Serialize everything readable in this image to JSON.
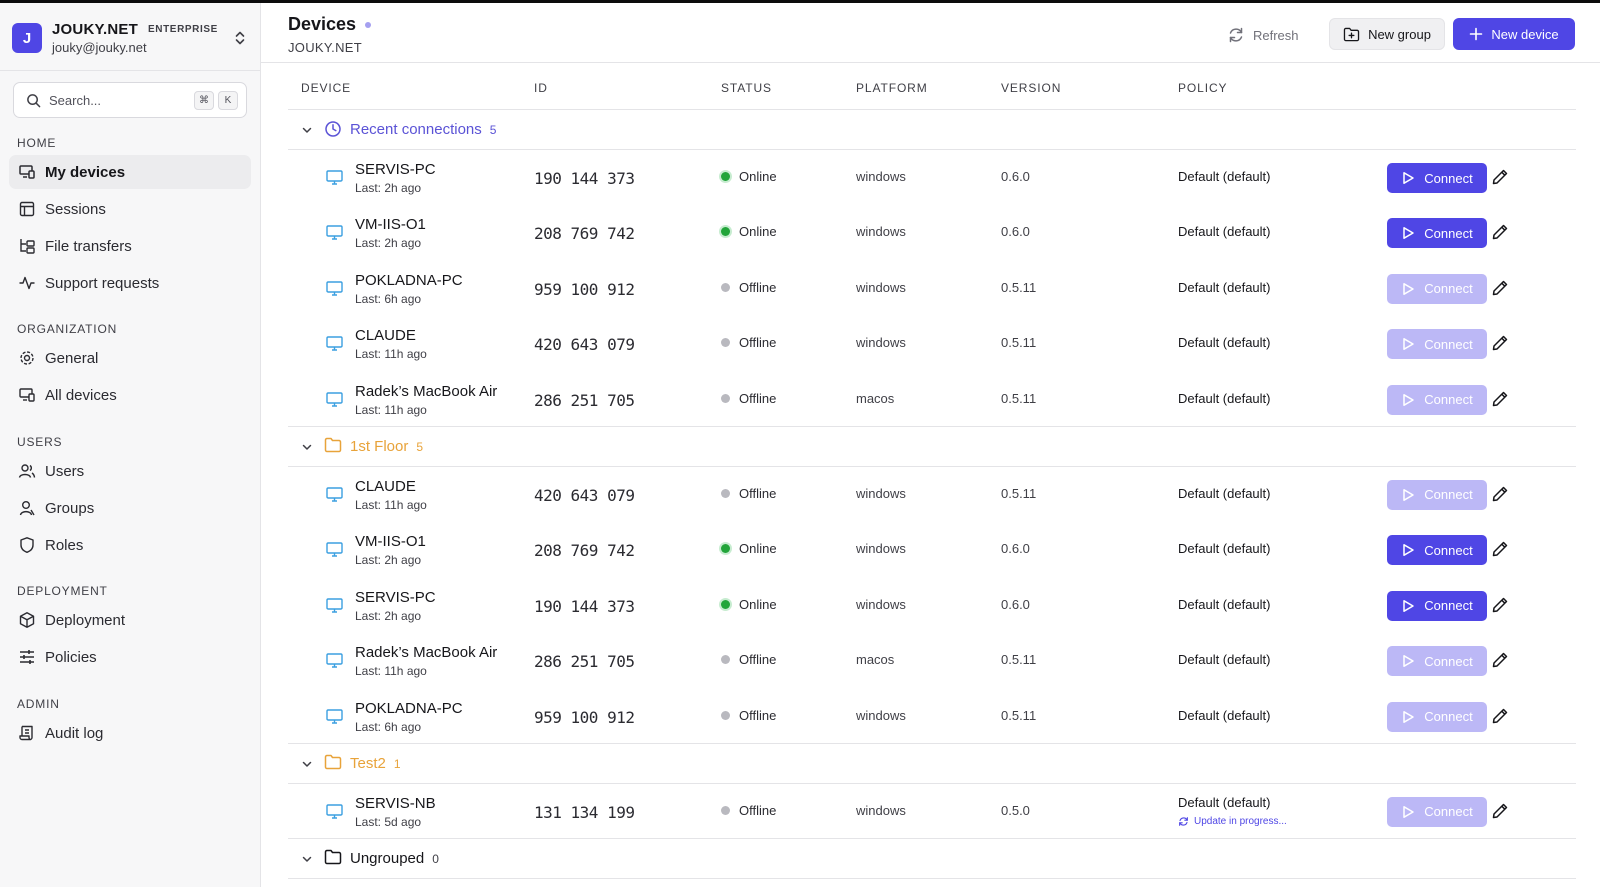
{
  "org": {
    "initial": "J",
    "name": "JOUKY.NET",
    "plan": "ENTERPRISE",
    "email": "jouky@jouky.net"
  },
  "search": {
    "placeholder": "Search...",
    "kbd1": "⌘",
    "kbd2": "K"
  },
  "nav": {
    "home": {
      "title": "HOME",
      "items": [
        "My devices",
        "Sessions",
        "File transfers",
        "Support requests"
      ]
    },
    "organization": {
      "title": "ORGANIZATION",
      "items": [
        "General",
        "All devices"
      ]
    },
    "users": {
      "title": "USERS",
      "items": [
        "Users",
        "Groups",
        "Roles"
      ]
    },
    "deployment": {
      "title": "DEPLOYMENT",
      "items": [
        "Deployment",
        "Policies"
      ]
    },
    "admin": {
      "title": "ADMIN",
      "items": [
        "Audit log"
      ]
    }
  },
  "header": {
    "title": "Devices",
    "subtitle": "JOUKY.NET",
    "refresh": "Refresh",
    "new_group": "New group",
    "new_device": "New device"
  },
  "columns": [
    "DEVICE",
    "ID",
    "STATUS",
    "PLATFORM",
    "VERSION",
    "POLICY"
  ],
  "connect_label": "Connect",
  "colors": {
    "accent": "#4f46e5",
    "recent": "#5b53d6",
    "folder": "#e8a33a",
    "online": "#22a53a",
    "offline": "#b9b9bf"
  },
  "groups": [
    {
      "label": "Recent connections",
      "count": "5",
      "devices": [
        {
          "name": "SERVIS-PC",
          "last": "Last: 2h ago",
          "id": "190 144 373",
          "status": "Online",
          "platform": "windows",
          "version": "0.6.0",
          "policy": "Default (default)"
        },
        {
          "name": "VM-IIS-O1",
          "last": "Last: 2h ago",
          "id": "208 769 742",
          "status": "Online",
          "platform": "windows",
          "version": "0.6.0",
          "policy": "Default (default)"
        },
        {
          "name": "POKLADNA-PC",
          "last": "Last: 6h ago",
          "id": "959 100 912",
          "status": "Offline",
          "platform": "windows",
          "version": "0.5.11",
          "policy": "Default (default)"
        },
        {
          "name": "CLAUDE",
          "last": "Last: 11h ago",
          "id": "420 643 079",
          "status": "Offline",
          "platform": "windows",
          "version": "0.5.11",
          "policy": "Default (default)"
        },
        {
          "name": "Radek’s MacBook Air",
          "last": "Last: 11h ago",
          "id": "286 251 705",
          "status": "Offline",
          "platform": "macos",
          "version": "0.5.11",
          "policy": "Default (default)"
        }
      ]
    },
    {
      "label": "1st Floor",
      "count": "5",
      "devices": [
        {
          "name": "CLAUDE",
          "last": "Last: 11h ago",
          "id": "420 643 079",
          "status": "Offline",
          "platform": "windows",
          "version": "0.5.11",
          "policy": "Default (default)"
        },
        {
          "name": "VM-IIS-O1",
          "last": "Last: 2h ago",
          "id": "208 769 742",
          "status": "Online",
          "platform": "windows",
          "version": "0.6.0",
          "policy": "Default (default)"
        },
        {
          "name": "SERVIS-PC",
          "last": "Last: 2h ago",
          "id": "190 144 373",
          "status": "Online",
          "platform": "windows",
          "version": "0.6.0",
          "policy": "Default (default)"
        },
        {
          "name": "Radek’s MacBook Air",
          "last": "Last: 11h ago",
          "id": "286 251 705",
          "status": "Offline",
          "platform": "macos",
          "version": "0.5.11",
          "policy": "Default (default)"
        },
        {
          "name": "POKLADNA-PC",
          "last": "Last: 6h ago",
          "id": "959 100 912",
          "status": "Offline",
          "platform": "windows",
          "version": "0.5.11",
          "policy": "Default (default)"
        }
      ]
    },
    {
      "label": "Test2",
      "count": "1",
      "devices": [
        {
          "name": "SERVIS-NB",
          "last": "Last: 5d ago",
          "id": "131 134 199",
          "status": "Offline",
          "platform": "windows",
          "version": "0.5.0",
          "policy": "Default (default)",
          "update": "Update in progress..."
        }
      ]
    },
    {
      "label": "Ungrouped",
      "count": "0",
      "devices": []
    }
  ]
}
